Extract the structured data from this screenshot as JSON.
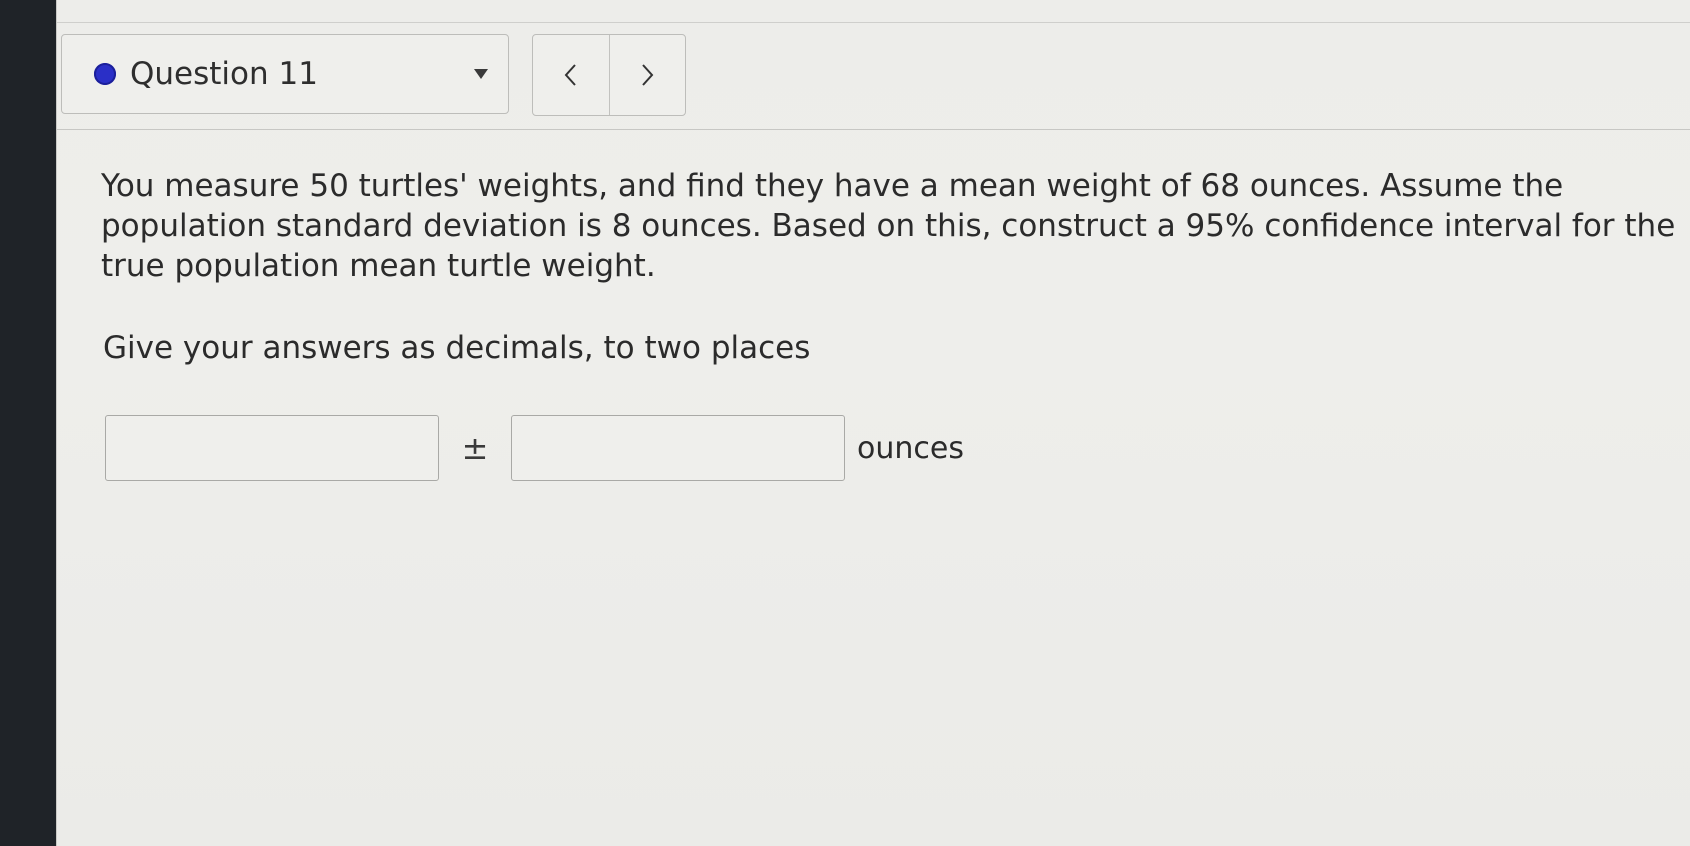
{
  "question_nav": {
    "title": "Question 11",
    "status_color": "#2a2fc7",
    "prev_icon": "chevron-left-icon",
    "next_icon": "chevron-right-icon"
  },
  "question": {
    "text": "You measure 50 turtles' weights, and find they have a mean weight of 68 ounces. Assume the population standard deviation is 8 ounces. Based on this, construct a 95% confidence interval for the true population mean turtle weight.",
    "instruction": "Give your answers as decimals, to two places"
  },
  "answer": {
    "estimate_value": "",
    "margin_value": "",
    "separator": "±",
    "unit": "ounces"
  }
}
